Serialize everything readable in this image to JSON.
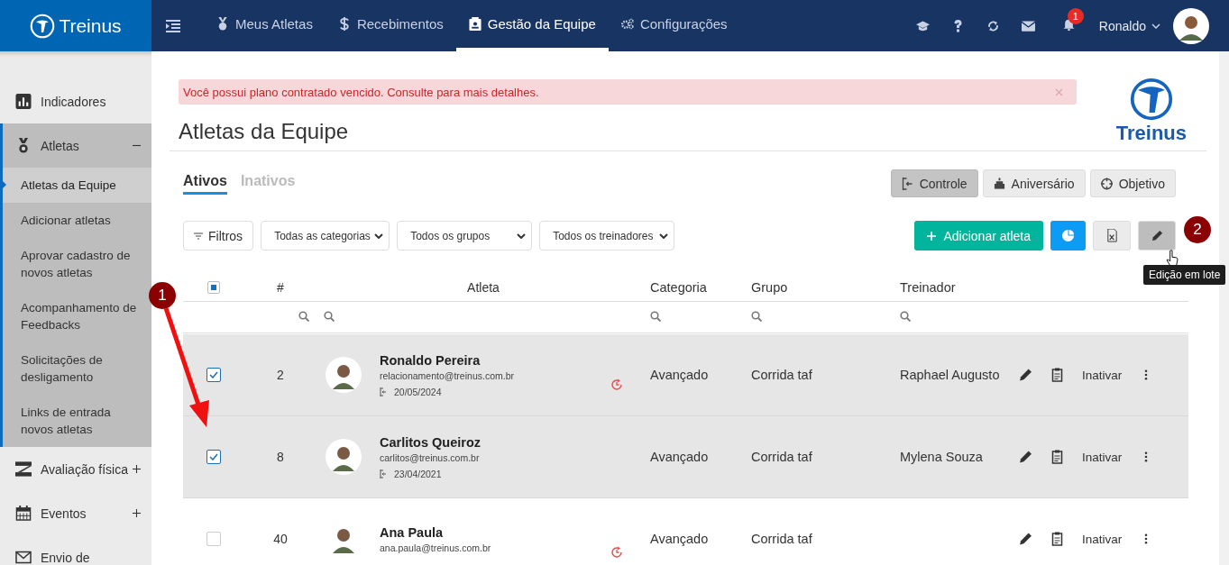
{
  "header": {
    "logo": "Treinus",
    "nav": [
      {
        "label": "Meus Atletas",
        "selected": false
      },
      {
        "label": "Recebimentos",
        "selected": false
      },
      {
        "label": "Gestão da Equipe",
        "selected": true
      },
      {
        "label": "Configurações",
        "selected": false
      }
    ],
    "notification_count": "1",
    "user": "Ronaldo"
  },
  "sidebar": {
    "items": [
      {
        "label": "Indicadores"
      },
      {
        "label": "Atletas",
        "expanded": true,
        "children": [
          {
            "label": "Atletas da Equipe",
            "selected": true
          },
          {
            "label": "Adicionar atletas",
            "selected": false
          },
          {
            "label": "Aprovar cadastro de novos atletas",
            "selected": false
          },
          {
            "label": "Acompanhamento de Feedbacks",
            "selected": false
          },
          {
            "label": "Solicitações de desligamento",
            "selected": false
          },
          {
            "label": "Links de entrada novos atletas",
            "selected": false
          }
        ]
      },
      {
        "label": "Avaliação física",
        "expanded": false
      },
      {
        "label": "Eventos",
        "expanded": false
      },
      {
        "label": "Envio de"
      }
    ]
  },
  "alert": "Você possui plano contratado vencido. Consulte para mais detalhes.",
  "brand": "Treinus",
  "title": "Atletas da Equipe",
  "tabs": [
    {
      "label": "Ativos",
      "selected": true
    },
    {
      "label": "Inativos",
      "selected": false
    }
  ],
  "views": [
    {
      "label": "Controle",
      "selected": true
    },
    {
      "label": "Aniversário",
      "selected": false
    },
    {
      "label": "Objetivo",
      "selected": false
    }
  ],
  "filters": {
    "button": "Filtros",
    "selects": [
      "Todas as categorias",
      "Todos os grupos",
      "Todos os treinadores"
    ]
  },
  "actions": [
    {
      "kind": "primary",
      "label": "Adicionar atleta"
    },
    {
      "kind": "chart"
    },
    {
      "kind": "excel"
    },
    {
      "kind": "edit",
      "hovered": true
    }
  ],
  "tooltip": "Edição em lote",
  "table": {
    "select_all_partial": true,
    "columns": [
      "#",
      "Atleta",
      "Categoria",
      "Grupo",
      "Treinador"
    ],
    "rows": [
      {
        "selected": true,
        "checked": true,
        "number": "2",
        "name": "Ronaldo Pereira",
        "email": "relacionamento@treinus.com.br",
        "date": "20/05/2024",
        "renewal": true,
        "category": "Avançado",
        "group": "Corrida taf",
        "coach": "Raphael Augusto",
        "action": "Inativar"
      },
      {
        "selected": true,
        "checked": true,
        "number": "8",
        "name": "Carlitos Queiroz",
        "email": "carlitos@treinus.com.br",
        "date": "23/04/2021",
        "renewal": false,
        "category": "Avançado",
        "group": "Corrida taf",
        "coach": "Mylena Souza",
        "action": "Inativar"
      },
      {
        "selected": false,
        "checked": false,
        "number": "40",
        "name": "Ana Paula",
        "email": "ana.paula@treinus.com.br",
        "renewal": true,
        "category": "Avançado",
        "group": "Corrida taf",
        "action": "Inativar"
      }
    ]
  },
  "annotations": [
    "1",
    "2"
  ]
}
